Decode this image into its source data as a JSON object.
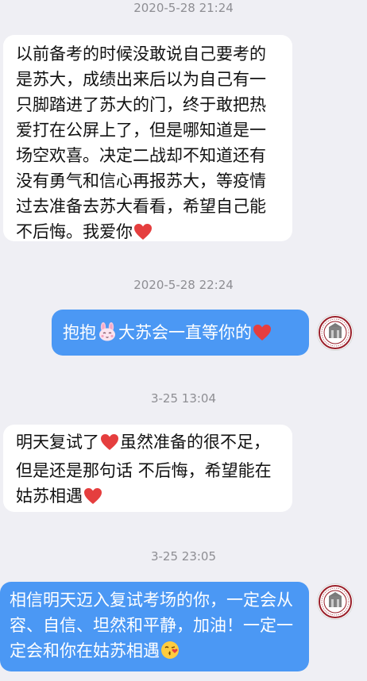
{
  "colors": {
    "background": "#efeff4",
    "incoming_bubble": "#ffffff",
    "outgoing_bubble": "#4b98f4",
    "timestamp": "#8e8e93",
    "heart": "#e53e3e"
  },
  "messages": [
    {
      "timestamp": "2020-5-28 21:24",
      "direction": "incoming",
      "text": "以前备考的时候没敢说自己要考的是苏大，成绩出来后以为自己有一只脚踏进了苏大的门，终于敢把热爱打在公屏上了，但是哪知道是一场空欢喜。决定二战却不知道还有没有勇气和信心再报苏大，等疫情过去准备去苏大看看，希望自己能不后悔。我爱你",
      "trailing_emoji": "heart-icon"
    },
    {
      "timestamp": "2020-5-28 22:24",
      "direction": "outgoing",
      "text_a": "抱抱",
      "text_b": "大苏会一直等你的",
      "emoji_a": "bunny-face-icon",
      "emoji_b": "heart-icon",
      "avatar": "university-seal-avatar"
    },
    {
      "timestamp": "3-25 13:04",
      "direction": "incoming",
      "text_a": "明天复试了",
      "text_b": "虽然准备的很不足，但是还是那句话 不后悔，希望能在姑苏相遇",
      "emoji": "heart-icon"
    },
    {
      "timestamp": "3-25 23:05",
      "direction": "outgoing",
      "text": "相信明天迈入复试考场的你，一定会从容、自信、坦然和平静，加油！一定一定会和你在姑苏相遇",
      "trailing_emoji": "kissing-face-icon",
      "avatar": "university-seal-avatar"
    }
  ]
}
